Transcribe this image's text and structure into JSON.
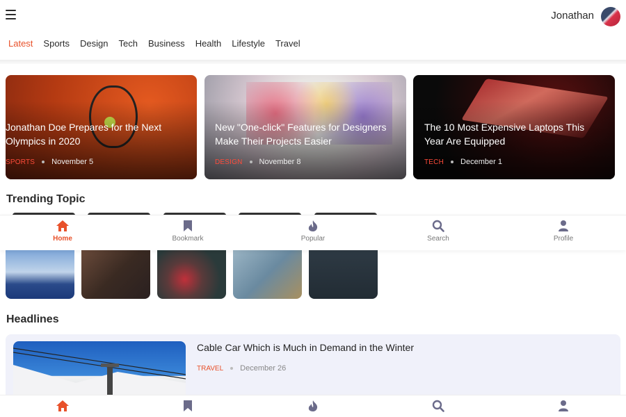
{
  "header": {
    "username": "Jonathan"
  },
  "tabs": [
    {
      "label": "Latest",
      "active": true
    },
    {
      "label": "Sports"
    },
    {
      "label": "Design"
    },
    {
      "label": "Tech"
    },
    {
      "label": "Business"
    },
    {
      "label": "Health"
    },
    {
      "label": "Lifestyle"
    },
    {
      "label": "Travel"
    }
  ],
  "featured": [
    {
      "title": "Jonathan Doe Prepares for the Next Olympics in 2020",
      "category": "SPORTS",
      "date": "November 5"
    },
    {
      "title": "New \"One-click\" Features for Designers Make Their Projects Easier",
      "category": "DESIGN",
      "date": "November 8"
    },
    {
      "title": "The 10 Most Expensive Laptops This Year Are Equipped",
      "category": "TECH",
      "date": "December 1"
    }
  ],
  "sections": {
    "trending": "Trending Topic",
    "headlines": "Headlines"
  },
  "nav": [
    {
      "label": "Home",
      "icon": "home-icon",
      "active": true
    },
    {
      "label": "Bookmark",
      "icon": "bookmark-icon"
    },
    {
      "label": "Popular",
      "icon": "flame-icon"
    },
    {
      "label": "Search",
      "icon": "search-icon"
    },
    {
      "label": "Profile",
      "icon": "user-icon"
    }
  ],
  "headline": {
    "title": "Cable Car Which is Much in Demand in the Winter",
    "category": "TRAVEL",
    "date": "December 26"
  },
  "colors": {
    "accent": "#e8512a",
    "muted": "#777777",
    "headline_bg": "#f0f1fa"
  }
}
